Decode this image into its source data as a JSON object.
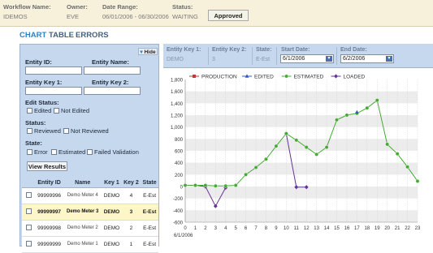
{
  "topbar": {
    "workflow_label": "Workflow Name:",
    "workflow_value": "IDEMOS",
    "owner_label": "Owner:",
    "owner_value": "EVE",
    "date_label": "Date Range:",
    "date_value": "06/01/2006 - 06/30/2006",
    "status_label": "Status:",
    "status_value": "WAITING",
    "approved_label": "Approved"
  },
  "tabs": [
    {
      "label": "CHART",
      "active": true
    },
    {
      "label": "TABLE",
      "active": false
    },
    {
      "label": "ERRORS",
      "active": false
    }
  ],
  "filter": {
    "hide_label": "Hide",
    "entity_id_label": "Entity ID:",
    "entity_name_label": "Entity Name:",
    "entity_key1_label": "Entity Key 1:",
    "entity_key2_label": "Entity Key 2:",
    "edit_status_label": "Edit Status:",
    "edited_label": "Edited",
    "not_edited_label": "Not Edited",
    "status_label": "Status:",
    "reviewed_label": "Reviewed",
    "not_reviewed_label": "Not Reviewed",
    "state_label": "State:",
    "error_label": "Error",
    "estimated_label": "Estimated",
    "failed_label": "Failed Validation",
    "view_results_label": "View Results"
  },
  "table": {
    "headers": [
      "Entity ID",
      "Name",
      "Key 1",
      "Key 2",
      "State"
    ],
    "rows": [
      {
        "id": "99999996",
        "name": "Demo Meter 4",
        "key1": "DEMO",
        "key2": "4",
        "state": "E-Est",
        "selected": false
      },
      {
        "id": "99999997",
        "name": "Demo Meter 3",
        "key1": "DEMO",
        "key2": "3",
        "state": "E-Est",
        "selected": true
      },
      {
        "id": "99999998",
        "name": "Demo Meter 2",
        "key1": "DEMO",
        "key2": "2",
        "state": "E-Est",
        "selected": false
      },
      {
        "id": "99999999",
        "name": "Demo Meter 1",
        "key1": "DEMO",
        "key2": "1",
        "state": "E-Est",
        "selected": false
      }
    ]
  },
  "detail": {
    "entity_key1_label": "Entity Key 1:",
    "entity_key1_value": "DEMO",
    "entity_key2_label": "Entity Key 2:",
    "entity_key2_value": "3",
    "state_label": "State:",
    "state_value": "E-Est",
    "start_date_label": "Start Date:",
    "start_date_value": "6/1/2006",
    "end_date_label": "End Date:",
    "end_date_value": "6/2/2006"
  },
  "colors": {
    "production": "#cc3333",
    "edited": "#3355cc",
    "estimated": "#44aa33",
    "loaded": "#663399"
  },
  "chart_data": {
    "type": "line",
    "x": [
      0,
      1,
      2,
      3,
      4,
      5,
      6,
      7,
      8,
      9,
      10,
      11,
      12,
      13,
      14,
      15,
      16,
      17,
      18,
      19,
      20,
      21,
      22,
      23
    ],
    "x_ticks": [
      "0",
      "1",
      "2",
      "3",
      "4",
      "5",
      "6",
      "7",
      "8",
      "9",
      "10",
      "11",
      "12",
      "13",
      "14",
      "15",
      "16",
      "17",
      "18",
      "19",
      "20",
      "21",
      "22",
      "23"
    ],
    "date_label": "6/1/2006",
    "ylim": [
      -600,
      1800
    ],
    "y_ticks": [
      "1,800",
      "1,600",
      "1,400",
      "1,200",
      "1,000",
      "800",
      "600",
      "400",
      "200",
      "0",
      "-200",
      "-400",
      "-600"
    ],
    "legend": [
      "PRODUCTION",
      "EDITED",
      "ESTIMATED",
      "LOADED"
    ],
    "legend_position": "top",
    "series": [
      {
        "name": "LOADED",
        "values": [
          20,
          20,
          0,
          -330,
          -20,
          null,
          null,
          null,
          null,
          null,
          890,
          -10,
          -10,
          null,
          null,
          null,
          null,
          null,
          null,
          null,
          null,
          null,
          null,
          null
        ]
      },
      {
        "name": "ESTIMATED",
        "values": [
          20,
          20,
          20,
          10,
          10,
          20,
          200,
          320,
          460,
          680,
          890,
          780,
          660,
          540,
          660,
          1120,
          1200,
          1230,
          1320,
          1450,
          710,
          550,
          330,
          90
        ]
      },
      {
        "name": "EDITED",
        "values": [
          null,
          null,
          null,
          null,
          null,
          null,
          null,
          null,
          null,
          null,
          null,
          null,
          null,
          null,
          null,
          null,
          null,
          1250,
          null,
          null,
          null,
          null,
          null,
          null
        ]
      }
    ]
  }
}
